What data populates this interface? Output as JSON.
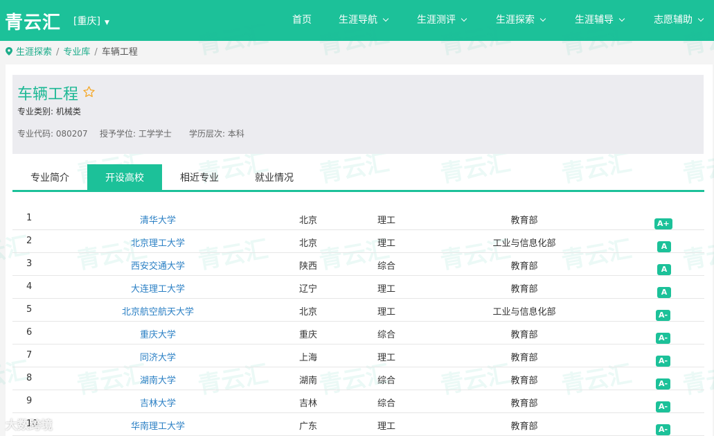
{
  "header": {
    "logo": "青云汇",
    "city": "[重庆]",
    "nav": [
      {
        "label": "首页",
        "dropdown": false
      },
      {
        "label": "生涯导航",
        "dropdown": true
      },
      {
        "label": "生涯测评",
        "dropdown": true
      },
      {
        "label": "生涯探索",
        "dropdown": true
      },
      {
        "label": "生涯辅导",
        "dropdown": true
      },
      {
        "label": "志愿辅助",
        "dropdown": true
      }
    ]
  },
  "breadcrumb": [
    "生涯探索",
    "专业库",
    "车辆工程"
  ],
  "major": {
    "name": "车辆工程",
    "category": "专业类别: 机械类",
    "code": "专业代码: 080207",
    "degree": "授予学位: 工学学士",
    "level": "学历层次: 本科"
  },
  "tabs": [
    "专业简介",
    "开设高校",
    "相近专业",
    "就业情况"
  ],
  "active_tab": 1,
  "universities": [
    {
      "num": "1",
      "name": "清华大学",
      "city": "北京",
      "type": "理工",
      "dept": "教育部",
      "grade": "A+"
    },
    {
      "num": "2",
      "name": "北京理工大学",
      "city": "北京",
      "type": "理工",
      "dept": "工业与信息化部",
      "grade": "A"
    },
    {
      "num": "3",
      "name": "西安交通大学",
      "city": "陕西",
      "type": "综合",
      "dept": "教育部",
      "grade": "A"
    },
    {
      "num": "4",
      "name": "大连理工大学",
      "city": "辽宁",
      "type": "理工",
      "dept": "教育部",
      "grade": "A"
    },
    {
      "num": "5",
      "name": "北京航空航天大学",
      "city": "北京",
      "type": "理工",
      "dept": "工业与信息化部",
      "grade": "A-"
    },
    {
      "num": "6",
      "name": "重庆大学",
      "city": "重庆",
      "type": "综合",
      "dept": "教育部",
      "grade": "A-"
    },
    {
      "num": "7",
      "name": "同济大学",
      "city": "上海",
      "type": "理工",
      "dept": "教育部",
      "grade": "A-"
    },
    {
      "num": "8",
      "name": "湖南大学",
      "city": "湖南",
      "type": "综合",
      "dept": "教育部",
      "grade": "A-"
    },
    {
      "num": "9",
      "name": "吉林大学",
      "city": "吉林",
      "type": "综合",
      "dept": "教育部",
      "grade": "A-"
    },
    {
      "num": "10",
      "name": "华南理工大学",
      "city": "广东",
      "type": "理工",
      "dept": "教育部",
      "grade": "A-"
    }
  ],
  "watermark": "青云汇",
  "corner_watermark": "大数跨境",
  "colors": {
    "accent": "#1cc199",
    "link": "#2a7fc4",
    "star": "#f5a623"
  }
}
